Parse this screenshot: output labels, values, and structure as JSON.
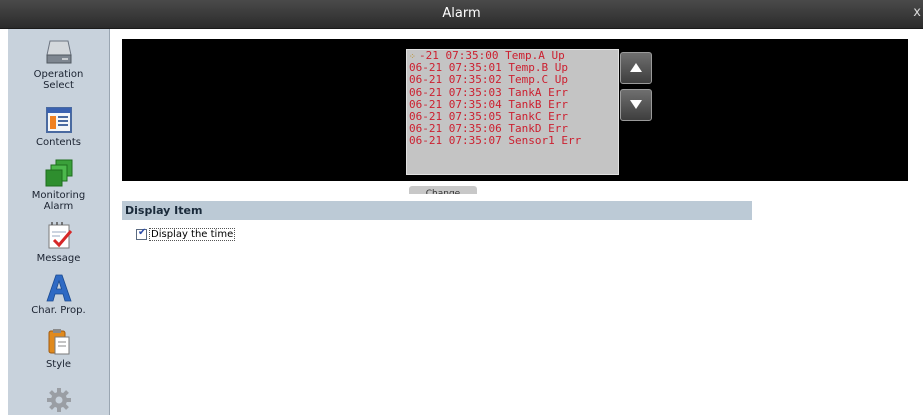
{
  "window": {
    "title": "Alarm",
    "close_glyph": "x"
  },
  "sidebar": {
    "items": [
      {
        "label": "Operation\nSelect",
        "icon": "hard-drive-icon"
      },
      {
        "label": "Contents",
        "icon": "list-window-icon"
      },
      {
        "label": "Monitoring\nAlarm",
        "icon": "stacked-squares-icon"
      },
      {
        "label": "Message",
        "icon": "notepad-check-icon"
      },
      {
        "label": "Char. Prop.",
        "icon": "letter-a-icon"
      },
      {
        "label": "Style",
        "icon": "clipboard-page-icon"
      },
      {
        "label": "",
        "icon": "gear-icon"
      }
    ]
  },
  "preview": {
    "alarm_rows": [
      "-21 07:35:00 Temp.A Up",
      "06-21 07:35:01 Temp.B Up",
      "06-21 07:35:02 Temp.C Up",
      "06-21 07:35:03 TankA Err",
      "06-21 07:35:04 TankB Err",
      "06-21 07:35:05 TankC Err",
      "06-21 07:35:06 TankD Err",
      "06-21 07:35:07 Sensor1 Err"
    ],
    "row_color": "#cc1f2f",
    "change_label": "Change"
  },
  "display_item": {
    "heading": "Display Item",
    "display_time": {
      "label": "Display the time",
      "checked": true
    }
  }
}
